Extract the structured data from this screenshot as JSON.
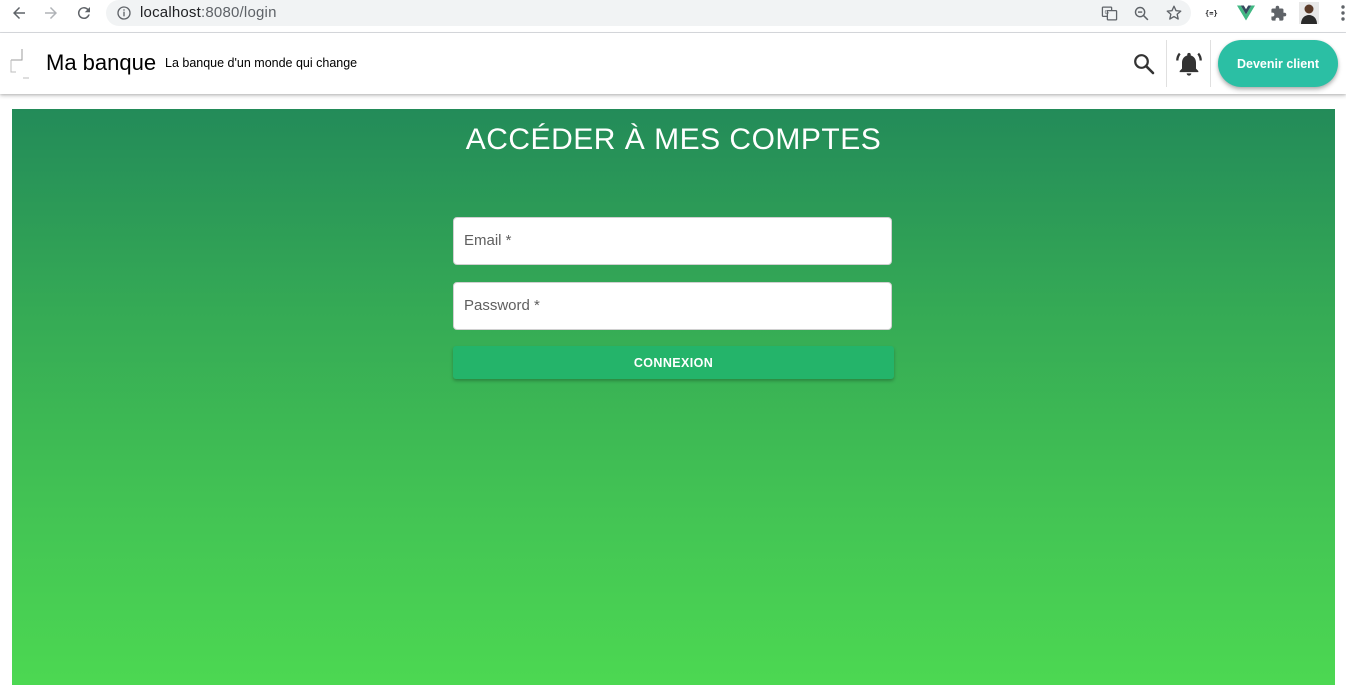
{
  "browser": {
    "url_host": "localhost",
    "url_rest": ":8080/login",
    "icons": {
      "back": "back-arrow-icon",
      "forward": "forward-arrow-icon",
      "reload": "reload-icon",
      "site_info": "info-icon",
      "translate": "translate-icon",
      "zoom": "zoom-out-icon",
      "bookmark": "star-icon",
      "extensions": [
        "json-ext-icon",
        "vue-devtools-icon",
        "puzzle-icon"
      ],
      "profile": "avatar",
      "menu": "kebab-menu-icon"
    }
  },
  "header": {
    "brand": "Ma banque",
    "tagline": "La banque d'un monde qui change",
    "cta_label": "Devenir client",
    "icons": [
      "search-icon",
      "bell-icon"
    ],
    "accent_color": "#2bbfa4"
  },
  "login": {
    "title": "ACCÉDER À MES COMPTES",
    "email_label": "Email *",
    "password_label": "Password *",
    "submit_label": "CONNEXION",
    "submit_color": "#24b46a",
    "gradient_colors": [
      "#238b59",
      "#4cd852"
    ]
  }
}
